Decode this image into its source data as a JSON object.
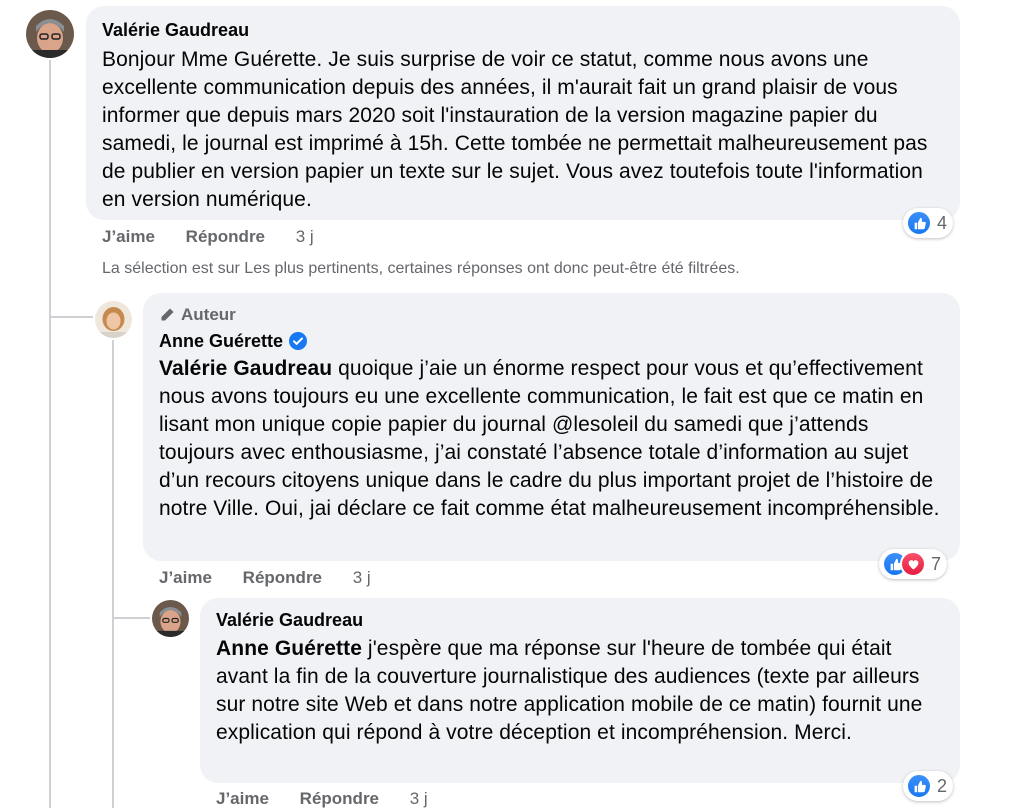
{
  "notice": "La sélection est sur Les plus pertinents, certaines réponses ont donc peut-être été filtrées.",
  "comments": [
    {
      "author": "Valérie Gaudreau",
      "text": "Bonjour Mme Guérette. Je suis surprise de voir ce statut, comme nous avons une excellente communication depuis des années, il m'aurait fait un grand plaisir de vous informer que depuis mars 2020 soit l'instauration de la version magazine papier du samedi, le journal est imprimé à 15h. Cette tombée ne permettait malheureusement pas de publier en version papier un texte sur le sujet. Vous avez toutefois toute l'information en version numérique.",
      "like": "J’aime",
      "reply": "Répondre",
      "time": "3 j",
      "reaction_count": "4",
      "reactions": [
        "like"
      ]
    },
    {
      "badge": "Auteur",
      "author": "Anne Guérette",
      "verified": true,
      "mention": "Valérie Gaudreau",
      "text": " quoique j’aie un énorme respect pour vous et qu’effectivement nous avons toujours eu une excellente communication, le fait est que ce matin en lisant mon unique copie papier du journal @lesoleil du samedi que j’attends toujours avec enthousiasme, j’ai constaté l’absence totale d’information au sujet d’un recours citoyens unique dans le cadre du plus important projet de l’histoire de notre Ville. Oui, jai déclare ce fait comme état malheureusement incompréhensible.",
      "like": "J’aime",
      "reply": "Répondre",
      "time": "3 j",
      "reaction_count": "7",
      "reactions": [
        "like",
        "love"
      ]
    },
    {
      "author": "Valérie Gaudreau",
      "mention": "Anne Guérette",
      "text": " j'espère que ma réponse sur l'heure de tombée qui était avant la fin de la couverture journalistique des audiences (texte par ailleurs sur notre site Web et dans notre application mobile de ce matin) fournit une explication qui répond à votre déception et incompréhension. Merci.",
      "like": "J’aime",
      "reply": "Répondre",
      "time": "3 j",
      "reaction_count": "2",
      "reactions": [
        "like"
      ]
    }
  ]
}
